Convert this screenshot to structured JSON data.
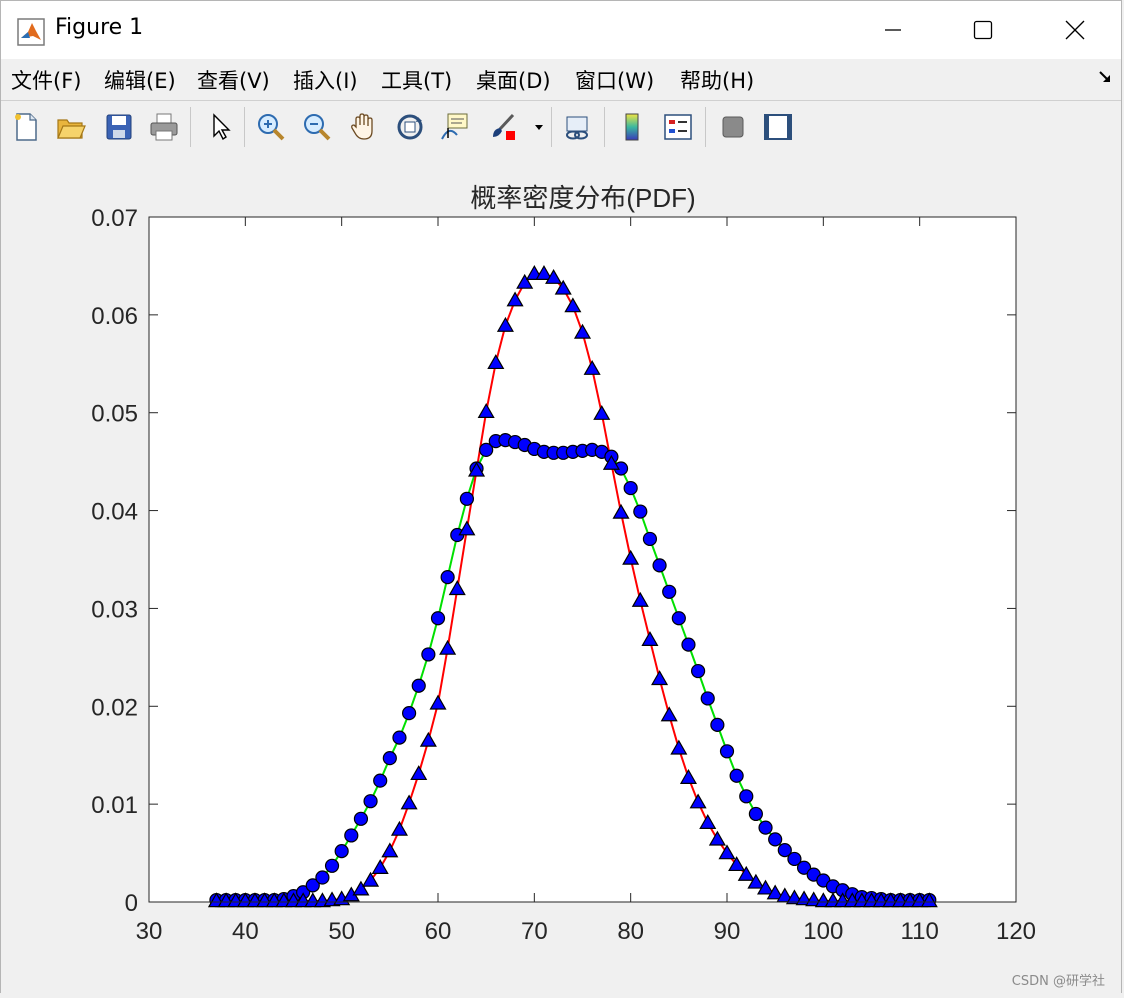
{
  "window": {
    "title": "Figure 1",
    "controls": {
      "minimize": "minimize",
      "maximize": "maximize",
      "close": "close"
    }
  },
  "menu": {
    "items": [
      "文件(F)",
      "编辑(E)",
      "查看(V)",
      "插入(I)",
      "工具(T)",
      "桌面(D)",
      "窗口(W)",
      "帮助(H)"
    ]
  },
  "toolbar": {
    "icons": [
      "new-file-icon",
      "open-folder-icon",
      "save-icon",
      "print-icon",
      "pointer-icon",
      "zoom-in-icon",
      "zoom-out-icon",
      "pan-hand-icon",
      "rotate-3d-icon",
      "data-cursor-icon",
      "brush-icon",
      "link-plot-icon",
      "colorbar-icon",
      "legend-icon",
      "hide-plot-tools-icon",
      "show-plot-tools-icon"
    ]
  },
  "watermark": "CSDN @研学社",
  "chart_data": {
    "type": "line",
    "title": "概率密度分布(PDF)",
    "xlabel": "",
    "ylabel": "",
    "xlim": [
      30,
      120
    ],
    "ylim": [
      0,
      0.07
    ],
    "xticks": [
      "30",
      "40",
      "50",
      "60",
      "70",
      "80",
      "90",
      "100",
      "110",
      "120"
    ],
    "yticks": [
      "0",
      "0.01",
      "0.02",
      "0.03",
      "0.04",
      "0.05",
      "0.06",
      "0.07"
    ],
    "grid": false,
    "legend": "none",
    "colors": {
      "circle_line": "#00e000",
      "triangle_line": "#ff0000",
      "marker_fill": "#0000ff",
      "marker_edge": "#000000"
    },
    "series": [
      {
        "marker": "circle",
        "x": [
          37,
          38,
          39,
          40,
          41,
          42,
          43,
          44,
          45,
          46,
          47,
          48,
          49,
          50,
          51,
          52,
          53,
          54,
          55,
          56,
          57,
          58,
          59,
          60,
          61,
          62,
          63,
          64,
          65,
          66,
          67,
          68,
          69,
          70,
          71,
          72,
          73,
          74,
          75,
          76,
          77,
          78,
          79,
          80,
          81,
          82,
          83,
          84,
          85,
          86,
          87,
          88,
          89,
          90,
          91,
          92,
          93,
          94,
          95,
          96,
          97,
          98,
          99,
          100,
          101,
          102,
          103,
          104,
          105,
          106,
          107,
          108,
          109,
          110,
          111
        ],
        "y": [
          0.0002,
          0.0002,
          0.0002,
          0.0002,
          0.0002,
          0.0002,
          0.0002,
          0.0003,
          0.0006,
          0.001,
          0.0017,
          0.0025,
          0.0037,
          0.0052,
          0.0068,
          0.0085,
          0.0103,
          0.0124,
          0.0147,
          0.0168,
          0.0193,
          0.0221,
          0.0253,
          0.029,
          0.0332,
          0.0375,
          0.0412,
          0.0443,
          0.0462,
          0.0471,
          0.0472,
          0.047,
          0.0467,
          0.0463,
          0.046,
          0.0459,
          0.0459,
          0.046,
          0.0461,
          0.0462,
          0.046,
          0.0455,
          0.0443,
          0.0423,
          0.0399,
          0.0371,
          0.0344,
          0.0317,
          0.029,
          0.0263,
          0.0236,
          0.0208,
          0.0181,
          0.0154,
          0.0129,
          0.0108,
          0.009,
          0.0076,
          0.0064,
          0.0053,
          0.0044,
          0.0035,
          0.0028,
          0.0022,
          0.0016,
          0.0012,
          0.0008,
          0.0005,
          0.0004,
          0.0003,
          0.0002,
          0.0002,
          0.0002,
          0.0002,
          0.0002
        ]
      },
      {
        "marker": "triangle",
        "x": [
          37,
          38,
          39,
          40,
          41,
          42,
          43,
          44,
          45,
          46,
          47,
          48,
          49,
          50,
          51,
          52,
          53,
          54,
          55,
          56,
          57,
          58,
          59,
          60,
          61,
          62,
          63,
          64,
          65,
          66,
          67,
          68,
          69,
          70,
          71,
          72,
          73,
          74,
          75,
          76,
          77,
          78,
          79,
          80,
          81,
          82,
          83,
          84,
          85,
          86,
          87,
          88,
          89,
          90,
          91,
          92,
          93,
          94,
          95,
          96,
          97,
          98,
          99,
          100,
          101,
          102,
          103,
          104,
          105,
          106,
          107,
          108,
          109,
          110,
          111
        ],
        "y": [
          0.0001,
          0.0001,
          0.0001,
          0.0001,
          0.0001,
          0.0001,
          0.0001,
          0.0001,
          0.0001,
          0.0001,
          0.0001,
          0.0001,
          0.0002,
          0.0003,
          0.0007,
          0.0013,
          0.0022,
          0.0035,
          0.0052,
          0.0074,
          0.0101,
          0.0131,
          0.0165,
          0.0203,
          0.0259,
          0.032,
          0.0381,
          0.0441,
          0.0501,
          0.0551,
          0.0589,
          0.0615,
          0.0633,
          0.0642,
          0.0642,
          0.0638,
          0.0627,
          0.0609,
          0.0582,
          0.0545,
          0.0499,
          0.0448,
          0.0398,
          0.0351,
          0.0308,
          0.0268,
          0.0228,
          0.0191,
          0.0157,
          0.0127,
          0.0102,
          0.0081,
          0.0064,
          0.005,
          0.0038,
          0.0028,
          0.002,
          0.0014,
          0.0009,
          0.0006,
          0.0004,
          0.0003,
          0.0002,
          0.0001,
          0.0001,
          0.0001,
          0.0001,
          0.0001,
          0.0001,
          0.0001,
          0.0001,
          0.0001,
          0.0001,
          0.0001,
          0.0001
        ]
      }
    ]
  }
}
